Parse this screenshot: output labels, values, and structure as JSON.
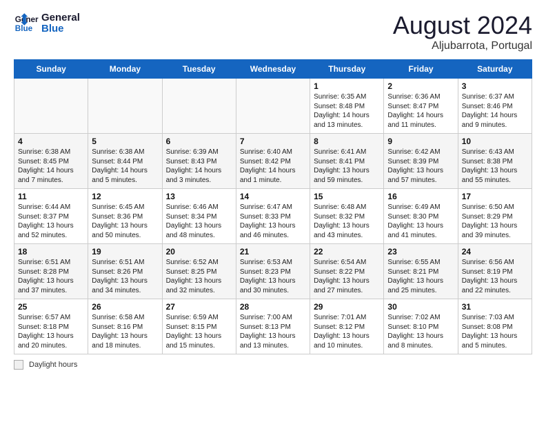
{
  "header": {
    "logo_line1": "General",
    "logo_line2": "Blue",
    "month_year": "August 2024",
    "location": "Aljubarrota, Portugal"
  },
  "weekdays": [
    "Sunday",
    "Monday",
    "Tuesday",
    "Wednesday",
    "Thursday",
    "Friday",
    "Saturday"
  ],
  "weeks": [
    [
      {
        "day": "",
        "info": ""
      },
      {
        "day": "",
        "info": ""
      },
      {
        "day": "",
        "info": ""
      },
      {
        "day": "",
        "info": ""
      },
      {
        "day": "1",
        "info": "Sunrise: 6:35 AM\nSunset: 8:48 PM\nDaylight: 14 hours and 13 minutes."
      },
      {
        "day": "2",
        "info": "Sunrise: 6:36 AM\nSunset: 8:47 PM\nDaylight: 14 hours and 11 minutes."
      },
      {
        "day": "3",
        "info": "Sunrise: 6:37 AM\nSunset: 8:46 PM\nDaylight: 14 hours and 9 minutes."
      }
    ],
    [
      {
        "day": "4",
        "info": "Sunrise: 6:38 AM\nSunset: 8:45 PM\nDaylight: 14 hours and 7 minutes."
      },
      {
        "day": "5",
        "info": "Sunrise: 6:38 AM\nSunset: 8:44 PM\nDaylight: 14 hours and 5 minutes."
      },
      {
        "day": "6",
        "info": "Sunrise: 6:39 AM\nSunset: 8:43 PM\nDaylight: 14 hours and 3 minutes."
      },
      {
        "day": "7",
        "info": "Sunrise: 6:40 AM\nSunset: 8:42 PM\nDaylight: 14 hours and 1 minute."
      },
      {
        "day": "8",
        "info": "Sunrise: 6:41 AM\nSunset: 8:41 PM\nDaylight: 13 hours and 59 minutes."
      },
      {
        "day": "9",
        "info": "Sunrise: 6:42 AM\nSunset: 8:39 PM\nDaylight: 13 hours and 57 minutes."
      },
      {
        "day": "10",
        "info": "Sunrise: 6:43 AM\nSunset: 8:38 PM\nDaylight: 13 hours and 55 minutes."
      }
    ],
    [
      {
        "day": "11",
        "info": "Sunrise: 6:44 AM\nSunset: 8:37 PM\nDaylight: 13 hours and 52 minutes."
      },
      {
        "day": "12",
        "info": "Sunrise: 6:45 AM\nSunset: 8:36 PM\nDaylight: 13 hours and 50 minutes."
      },
      {
        "day": "13",
        "info": "Sunrise: 6:46 AM\nSunset: 8:34 PM\nDaylight: 13 hours and 48 minutes."
      },
      {
        "day": "14",
        "info": "Sunrise: 6:47 AM\nSunset: 8:33 PM\nDaylight: 13 hours and 46 minutes."
      },
      {
        "day": "15",
        "info": "Sunrise: 6:48 AM\nSunset: 8:32 PM\nDaylight: 13 hours and 43 minutes."
      },
      {
        "day": "16",
        "info": "Sunrise: 6:49 AM\nSunset: 8:30 PM\nDaylight: 13 hours and 41 minutes."
      },
      {
        "day": "17",
        "info": "Sunrise: 6:50 AM\nSunset: 8:29 PM\nDaylight: 13 hours and 39 minutes."
      }
    ],
    [
      {
        "day": "18",
        "info": "Sunrise: 6:51 AM\nSunset: 8:28 PM\nDaylight: 13 hours and 37 minutes."
      },
      {
        "day": "19",
        "info": "Sunrise: 6:51 AM\nSunset: 8:26 PM\nDaylight: 13 hours and 34 minutes."
      },
      {
        "day": "20",
        "info": "Sunrise: 6:52 AM\nSunset: 8:25 PM\nDaylight: 13 hours and 32 minutes."
      },
      {
        "day": "21",
        "info": "Sunrise: 6:53 AM\nSunset: 8:23 PM\nDaylight: 13 hours and 30 minutes."
      },
      {
        "day": "22",
        "info": "Sunrise: 6:54 AM\nSunset: 8:22 PM\nDaylight: 13 hours and 27 minutes."
      },
      {
        "day": "23",
        "info": "Sunrise: 6:55 AM\nSunset: 8:21 PM\nDaylight: 13 hours and 25 minutes."
      },
      {
        "day": "24",
        "info": "Sunrise: 6:56 AM\nSunset: 8:19 PM\nDaylight: 13 hours and 22 minutes."
      }
    ],
    [
      {
        "day": "25",
        "info": "Sunrise: 6:57 AM\nSunset: 8:18 PM\nDaylight: 13 hours and 20 minutes."
      },
      {
        "day": "26",
        "info": "Sunrise: 6:58 AM\nSunset: 8:16 PM\nDaylight: 13 hours and 18 minutes."
      },
      {
        "day": "27",
        "info": "Sunrise: 6:59 AM\nSunset: 8:15 PM\nDaylight: 13 hours and 15 minutes."
      },
      {
        "day": "28",
        "info": "Sunrise: 7:00 AM\nSunset: 8:13 PM\nDaylight: 13 hours and 13 minutes."
      },
      {
        "day": "29",
        "info": "Sunrise: 7:01 AM\nSunset: 8:12 PM\nDaylight: 13 hours and 10 minutes."
      },
      {
        "day": "30",
        "info": "Sunrise: 7:02 AM\nSunset: 8:10 PM\nDaylight: 13 hours and 8 minutes."
      },
      {
        "day": "31",
        "info": "Sunrise: 7:03 AM\nSunset: 8:08 PM\nDaylight: 13 hours and 5 minutes."
      }
    ]
  ],
  "legend": {
    "box_label": "Daylight hours"
  }
}
